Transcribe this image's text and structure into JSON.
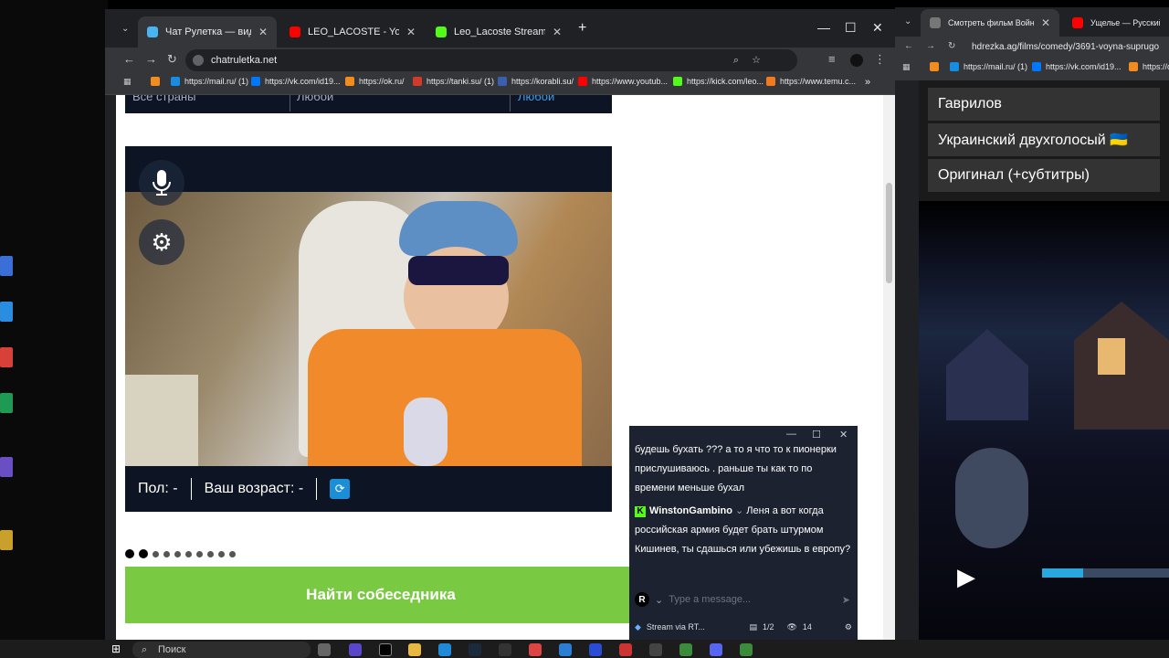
{
  "left_window": {
    "tabs": [
      {
        "title": "Чат Рулетка — видеочат",
        "color": "#4ab3f4",
        "active": true
      },
      {
        "title": "LEO_LACOSTE - YouTube",
        "color": "#ff0000",
        "active": false
      },
      {
        "title": "Leo_Lacoste Stream - Watch Li...",
        "color": "#53fc18",
        "active": false
      }
    ],
    "new_tab": "+",
    "controls": {
      "minimize": "—",
      "maximize": "☐",
      "close": "✕"
    },
    "url": "chatruletka.net",
    "bookmarks": [
      "https://mail.ru/ (1)",
      "https://vk.com/id19...",
      "https://ok.ru/",
      "https://tanki.su/ (1)",
      "https://korabli.su/",
      "https://www.youtub...",
      "https://kick.com/leo...",
      "https://www.temu.c..."
    ],
    "bookmarks_more": "»"
  },
  "chatruletka": {
    "filter_country": "Все страны",
    "filter_gender": "Любой",
    "filter_other": "Любой",
    "gender_label": "Пол: -",
    "age_label": "Ваш возраст: -",
    "find_button": "Найти собеседника"
  },
  "chat_overlay": {
    "messages": [
      {
        "user": "",
        "text": "будешь бухать ??? а то я что то к пионерки прислушиваюсь . раньше ты как то по времени меньше бухал"
      },
      {
        "user": "WinstonGambino",
        "text": "Леня а вот когда российская армия будет брать штурмом Кишинев, ты сдашься или убежишь в европу?"
      }
    ],
    "input_placeholder": "Type a message...",
    "footer_label": "Stream via RT...",
    "footer_page": "1/2",
    "viewer_count": "14"
  },
  "right_window": {
    "tabs": [
      {
        "title": "Смотреть фильм Война супру",
        "color": "#777"
      },
      {
        "title": "Ущелье — Русский трейл",
        "color": "#ff0000"
      }
    ],
    "url": "hdrezka.ag/films/comedy/3691-voyna-suprugo",
    "bookmarks": [
      "https://mail.ru/ (1)",
      "https://vk.com/id19...",
      "https://o"
    ],
    "voice_options": [
      "Гаврилов",
      "Украинский двухголосый 🇺🇦",
      "Оригинал (+субтитры)"
    ],
    "progress": 0.32
  },
  "taskbar": {
    "search_placeholder": "Поиск"
  }
}
